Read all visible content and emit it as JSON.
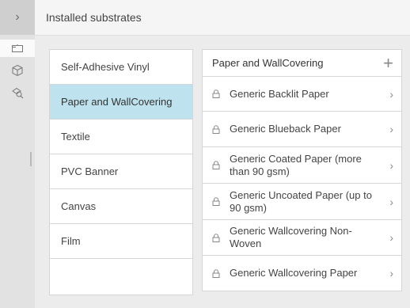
{
  "header": {
    "title": "Installed substrates",
    "back_icon": "chevron-right-icon"
  },
  "sidebar": {
    "icons": [
      "substrate-roll-icon",
      "cube-icon",
      "search-substrate-icon"
    ]
  },
  "categories": {
    "items": [
      "Self-Adhesive Vinyl",
      "Paper and WallCovering",
      "Textile",
      "PVC Banner",
      "Canvas",
      "Film"
    ],
    "selected": "Paper and WallCovering"
  },
  "substrates": {
    "title": "Paper and WallCovering",
    "add_icon": "plus-icon",
    "items": [
      "Generic Backlit Paper",
      "Generic Blueback Paper",
      "Generic Coated Paper (more than 90 gsm)",
      "Generic Uncoated Paper (up to 90 gsm)",
      "Generic Wallcovering Non-Woven",
      "Generic Wallcovering Paper"
    ]
  },
  "colors": {
    "selected_bg": "#bfe3ee",
    "rail_bg": "#e2e2e2"
  }
}
